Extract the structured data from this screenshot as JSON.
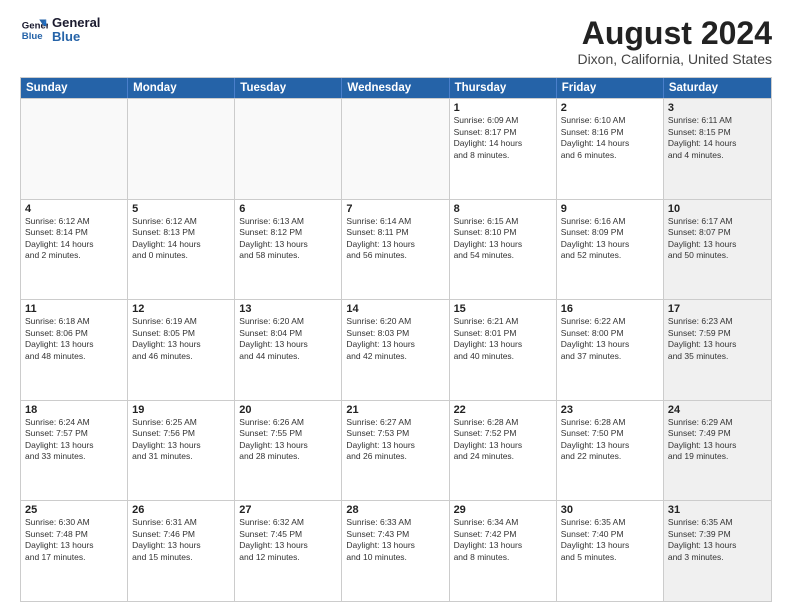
{
  "logo": {
    "line1": "General",
    "line2": "Blue"
  },
  "title": "August 2024",
  "location": "Dixon, California, United States",
  "days_of_week": [
    "Sunday",
    "Monday",
    "Tuesday",
    "Wednesday",
    "Thursday",
    "Friday",
    "Saturday"
  ],
  "weeks": [
    [
      {
        "day": "",
        "info": "",
        "empty": true
      },
      {
        "day": "",
        "info": "",
        "empty": true
      },
      {
        "day": "",
        "info": "",
        "empty": true
      },
      {
        "day": "",
        "info": "",
        "empty": true
      },
      {
        "day": "1",
        "info": "Sunrise: 6:09 AM\nSunset: 8:17 PM\nDaylight: 14 hours\nand 8 minutes."
      },
      {
        "day": "2",
        "info": "Sunrise: 6:10 AM\nSunset: 8:16 PM\nDaylight: 14 hours\nand 6 minutes."
      },
      {
        "day": "3",
        "info": "Sunrise: 6:11 AM\nSunset: 8:15 PM\nDaylight: 14 hours\nand 4 minutes.",
        "shaded": true
      }
    ],
    [
      {
        "day": "4",
        "info": "Sunrise: 6:12 AM\nSunset: 8:14 PM\nDaylight: 14 hours\nand 2 minutes."
      },
      {
        "day": "5",
        "info": "Sunrise: 6:12 AM\nSunset: 8:13 PM\nDaylight: 14 hours\nand 0 minutes."
      },
      {
        "day": "6",
        "info": "Sunrise: 6:13 AM\nSunset: 8:12 PM\nDaylight: 13 hours\nand 58 minutes."
      },
      {
        "day": "7",
        "info": "Sunrise: 6:14 AM\nSunset: 8:11 PM\nDaylight: 13 hours\nand 56 minutes."
      },
      {
        "day": "8",
        "info": "Sunrise: 6:15 AM\nSunset: 8:10 PM\nDaylight: 13 hours\nand 54 minutes."
      },
      {
        "day": "9",
        "info": "Sunrise: 6:16 AM\nSunset: 8:09 PM\nDaylight: 13 hours\nand 52 minutes."
      },
      {
        "day": "10",
        "info": "Sunrise: 6:17 AM\nSunset: 8:07 PM\nDaylight: 13 hours\nand 50 minutes.",
        "shaded": true
      }
    ],
    [
      {
        "day": "11",
        "info": "Sunrise: 6:18 AM\nSunset: 8:06 PM\nDaylight: 13 hours\nand 48 minutes."
      },
      {
        "day": "12",
        "info": "Sunrise: 6:19 AM\nSunset: 8:05 PM\nDaylight: 13 hours\nand 46 minutes."
      },
      {
        "day": "13",
        "info": "Sunrise: 6:20 AM\nSunset: 8:04 PM\nDaylight: 13 hours\nand 44 minutes."
      },
      {
        "day": "14",
        "info": "Sunrise: 6:20 AM\nSunset: 8:03 PM\nDaylight: 13 hours\nand 42 minutes."
      },
      {
        "day": "15",
        "info": "Sunrise: 6:21 AM\nSunset: 8:01 PM\nDaylight: 13 hours\nand 40 minutes."
      },
      {
        "day": "16",
        "info": "Sunrise: 6:22 AM\nSunset: 8:00 PM\nDaylight: 13 hours\nand 37 minutes."
      },
      {
        "day": "17",
        "info": "Sunrise: 6:23 AM\nSunset: 7:59 PM\nDaylight: 13 hours\nand 35 minutes.",
        "shaded": true
      }
    ],
    [
      {
        "day": "18",
        "info": "Sunrise: 6:24 AM\nSunset: 7:57 PM\nDaylight: 13 hours\nand 33 minutes."
      },
      {
        "day": "19",
        "info": "Sunrise: 6:25 AM\nSunset: 7:56 PM\nDaylight: 13 hours\nand 31 minutes."
      },
      {
        "day": "20",
        "info": "Sunrise: 6:26 AM\nSunset: 7:55 PM\nDaylight: 13 hours\nand 28 minutes."
      },
      {
        "day": "21",
        "info": "Sunrise: 6:27 AM\nSunset: 7:53 PM\nDaylight: 13 hours\nand 26 minutes."
      },
      {
        "day": "22",
        "info": "Sunrise: 6:28 AM\nSunset: 7:52 PM\nDaylight: 13 hours\nand 24 minutes."
      },
      {
        "day": "23",
        "info": "Sunrise: 6:28 AM\nSunset: 7:50 PM\nDaylight: 13 hours\nand 22 minutes."
      },
      {
        "day": "24",
        "info": "Sunrise: 6:29 AM\nSunset: 7:49 PM\nDaylight: 13 hours\nand 19 minutes.",
        "shaded": true
      }
    ],
    [
      {
        "day": "25",
        "info": "Sunrise: 6:30 AM\nSunset: 7:48 PM\nDaylight: 13 hours\nand 17 minutes."
      },
      {
        "day": "26",
        "info": "Sunrise: 6:31 AM\nSunset: 7:46 PM\nDaylight: 13 hours\nand 15 minutes."
      },
      {
        "day": "27",
        "info": "Sunrise: 6:32 AM\nSunset: 7:45 PM\nDaylight: 13 hours\nand 12 minutes."
      },
      {
        "day": "28",
        "info": "Sunrise: 6:33 AM\nSunset: 7:43 PM\nDaylight: 13 hours\nand 10 minutes."
      },
      {
        "day": "29",
        "info": "Sunrise: 6:34 AM\nSunset: 7:42 PM\nDaylight: 13 hours\nand 8 minutes."
      },
      {
        "day": "30",
        "info": "Sunrise: 6:35 AM\nSunset: 7:40 PM\nDaylight: 13 hours\nand 5 minutes."
      },
      {
        "day": "31",
        "info": "Sunrise: 6:35 AM\nSunset: 7:39 PM\nDaylight: 13 hours\nand 3 minutes.",
        "shaded": true
      }
    ]
  ]
}
